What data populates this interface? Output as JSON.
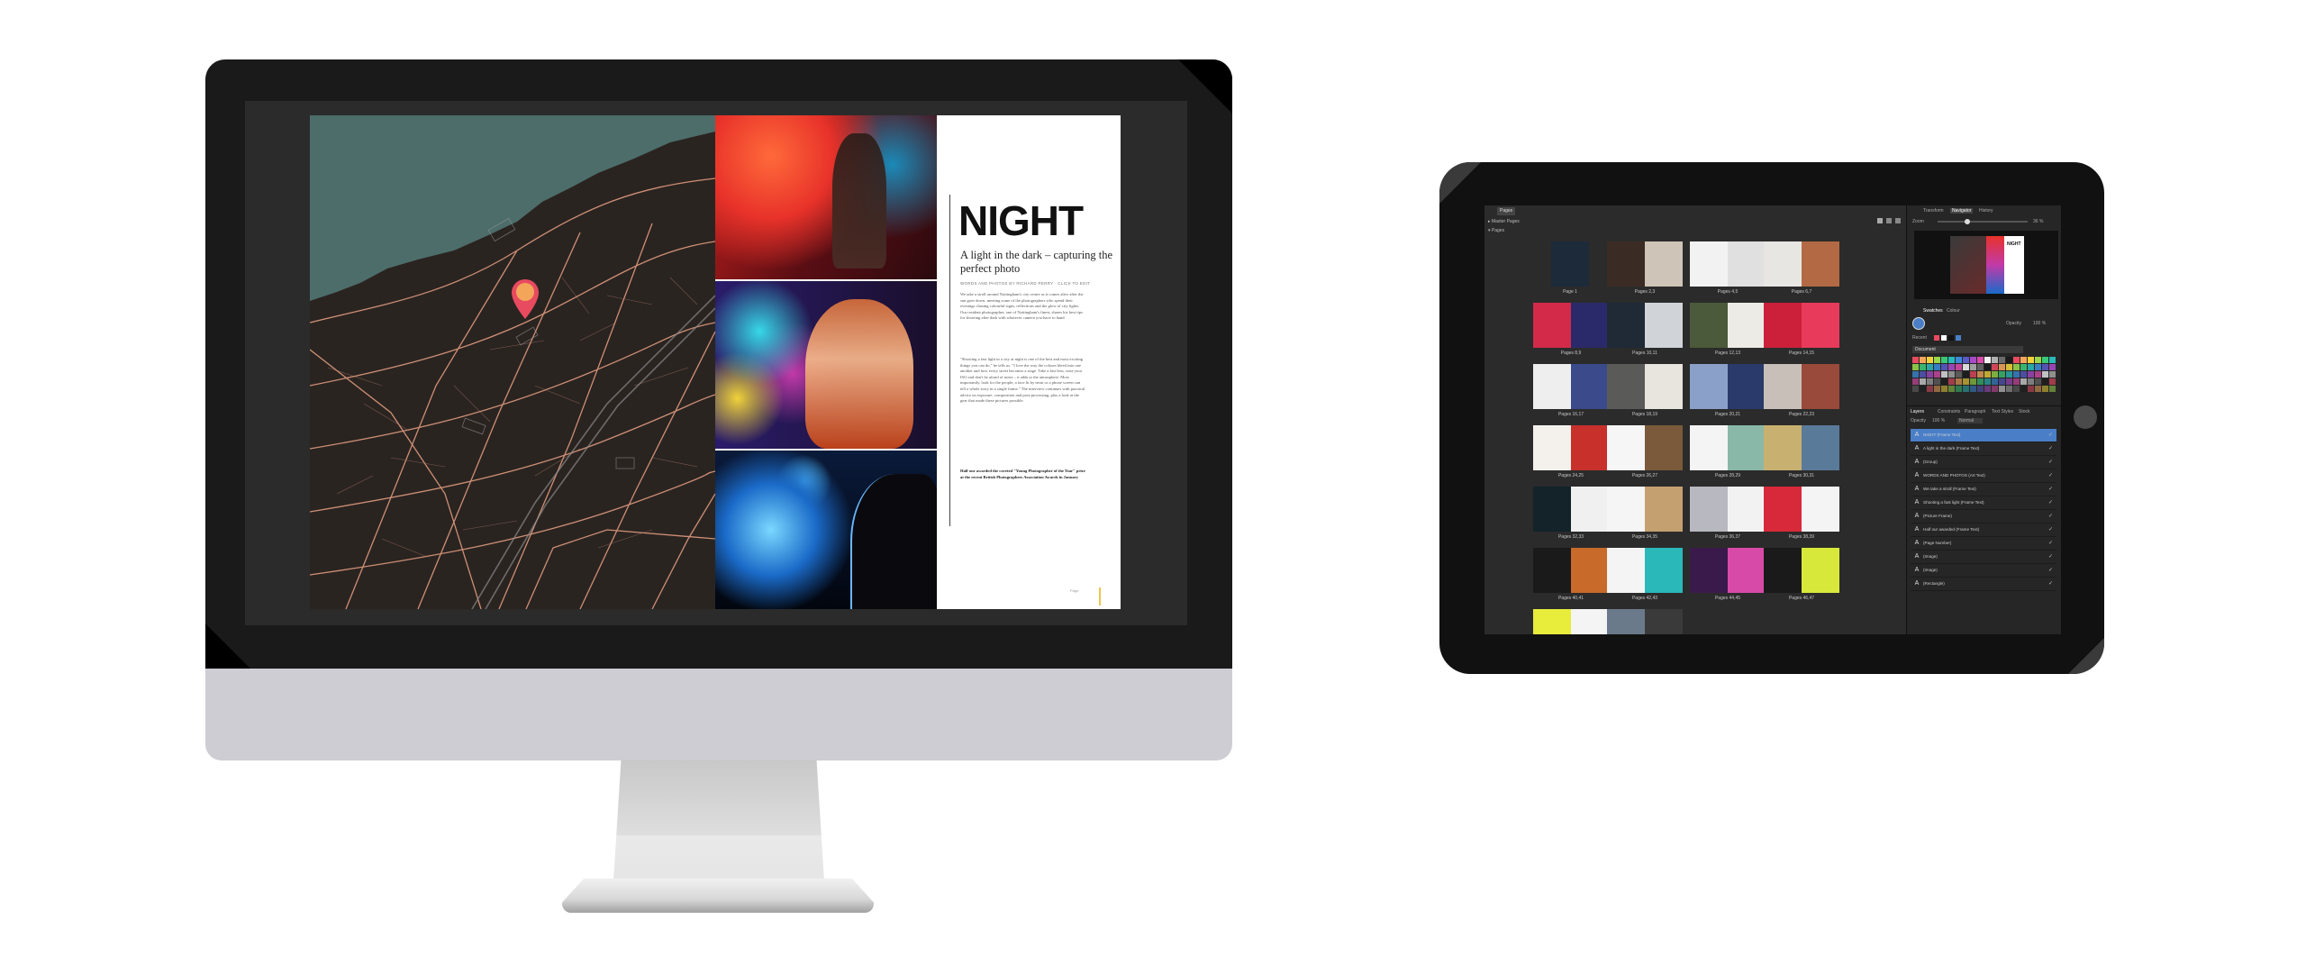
{
  "spread": {
    "title": "NIGHT",
    "subtitle": "A light in the dark – capturing the perfect photo",
    "credit": "WORDS AND PHOTOS BY RICHARD PERRY · CLICK TO EDIT",
    "body_1": "We take a stroll around Nottingham's city centre as it comes alive after the sun goes down, meeting some of the photographers who spend their evenings chasing colourful signs, reflections and the glow of city lights. Our resident photographer, one of Nottingham's finest, shares his best tips for shooting after dark with whatever camera you have to hand.",
    "body_2": "\"Shooting a fast light in a city at night is one of the best and most exciting things you can do,\" he tells us. \"I love the way the colours bleed into one another and how every street becomes a stage. Take a fast lens, raise your ISO and don't be afraid of noise – it adds to the atmosphere. Most importantly, look for the people; a face lit by neon or a phone screen can tell a whole story in a single frame.\" The interview continues with practical advice on exposure, composition and post-processing, plus a look at the gear that made these pictures possible.",
    "pullout": "Half our awarded the coveted \"Young Photographer of the Year\" prize at the recent British Photographers Association Awards in January",
    "folio": "Page"
  },
  "ipad": {
    "tabs": {
      "pages": "Pages",
      "transform": "Transform",
      "navigator": "Navigator",
      "history": "History"
    },
    "tree": {
      "master": "Master Pages",
      "pages": "Pages"
    },
    "pages": [
      {
        "label": "Page 1",
        "colors": [
          "#1d2a3a",
          "#7a4a3a"
        ]
      },
      {
        "label": "Pages 2,3",
        "colors": [
          "#3a2c24",
          "#cfc4b8"
        ]
      },
      {
        "label": "Pages 4,5",
        "colors": [
          "#f2f2f2",
          "#e0e0e0"
        ]
      },
      {
        "label": "Pages 6,7",
        "colors": [
          "#e8e6e2",
          "#b36a44"
        ]
      },
      {
        "label": "Pages 8,9",
        "colors": [
          "#d32a4a",
          "#2a2a6a"
        ]
      },
      {
        "label": "Pages 10,11",
        "colors": [
          "#1f2a36",
          "#d0d4d8"
        ]
      },
      {
        "label": "Pages 12,13",
        "colors": [
          "#4a5a3a",
          "#ecebe6"
        ]
      },
      {
        "label": "Pages 14,15",
        "colors": [
          "#cc1f3a",
          "#e83a5a"
        ]
      },
      {
        "label": "Pages 16,17",
        "colors": [
          "#eeeeee",
          "#3a4a8a"
        ]
      },
      {
        "label": "Pages 18,19",
        "colors": [
          "#5a5a58",
          "#e8e4de"
        ]
      },
      {
        "label": "Pages 20,21",
        "colors": [
          "#8aa0c8",
          "#2a3a6a"
        ]
      },
      {
        "label": "Pages 22,23",
        "colors": [
          "#c8c0b8",
          "#9a4a3a"
        ]
      },
      {
        "label": "Pages 24,25",
        "colors": [
          "#f4f0ec",
          "#c8302c"
        ]
      },
      {
        "label": "Pages 26,27",
        "colors": [
          "#f6f6f6",
          "#7a5a3a"
        ]
      },
      {
        "label": "Pages 28,29",
        "colors": [
          "#f4f4f4",
          "#8ab8a8"
        ]
      },
      {
        "label": "Pages 30,31",
        "colors": [
          "#c8b070",
          "#5a7a9a"
        ]
      },
      {
        "label": "Pages 32,33",
        "colors": [
          "#14232a",
          "#f0f0f0"
        ]
      },
      {
        "label": "Pages 34,35",
        "colors": [
          "#f5f5f5",
          "#c4a070"
        ]
      },
      {
        "label": "Pages 36,37",
        "colors": [
          "#b8b8c0",
          "#f2f2f2"
        ]
      },
      {
        "label": "Pages 38,39",
        "colors": [
          "#d8293a",
          "#f4f4f4"
        ]
      },
      {
        "label": "Pages 40,41",
        "colors": [
          "#1a1a1a",
          "#c86a2a"
        ]
      },
      {
        "label": "Pages 42,43",
        "colors": [
          "#f4f4f4",
          "#2ab8b8"
        ]
      },
      {
        "label": "Pages 44,45",
        "colors": [
          "#3a1a4a",
          "#d84aa8"
        ]
      },
      {
        "label": "Pages 46,47",
        "colors": [
          "#1a1a1a",
          "#d8e83a"
        ]
      },
      {
        "label": "",
        "colors": [
          "#e8ec3a",
          "#f4f4f4"
        ]
      },
      {
        "label": "",
        "colors": [
          "#6a7a8a",
          "#3a3a3a"
        ]
      }
    ],
    "right": {
      "zoom_label": "Zoom",
      "zoom_value": "36 %",
      "swatches_title": "Swatches",
      "color_tab": "Colour",
      "opacity_label": "Opacity",
      "opacity_value": "100 %",
      "recent_label": "Recent",
      "palette_name": "Document",
      "layers_tabs": [
        "Layers",
        "Constraints",
        "Paragraph",
        "Text Styles",
        "Stock"
      ],
      "opacity_small": "Opacity",
      "opacity_small_value": "100 %",
      "blend": "Normal",
      "layers": [
        {
          "name": "NIGHT (Frame Text)",
          "selected": true
        },
        {
          "name": "A light in the dark (Frame Text)",
          "selected": false
        },
        {
          "name": "(Group)",
          "selected": false
        },
        {
          "name": "WORDS AND PHOTOS (Art Text)",
          "selected": false
        },
        {
          "name": "We take a stroll (Frame Text)",
          "selected": false
        },
        {
          "name": "Shooting a fast light (Frame Text)",
          "selected": false
        },
        {
          "name": "(Picture Frame)",
          "selected": false
        },
        {
          "name": "Half our awarded (Frame Text)",
          "selected": false
        },
        {
          "name": "(Page Number)",
          "selected": false
        },
        {
          "name": "(Image)",
          "selected": false
        },
        {
          "name": "(Image)",
          "selected": false
        },
        {
          "name": "(Rectangle)",
          "selected": false
        }
      ]
    }
  },
  "colors": {
    "accent": "#4a7fc8",
    "map_water": "#4d6d6a",
    "map_roads": "#d7957a",
    "pin": "#e84a5f",
    "pin_center": "#f3a65a"
  }
}
